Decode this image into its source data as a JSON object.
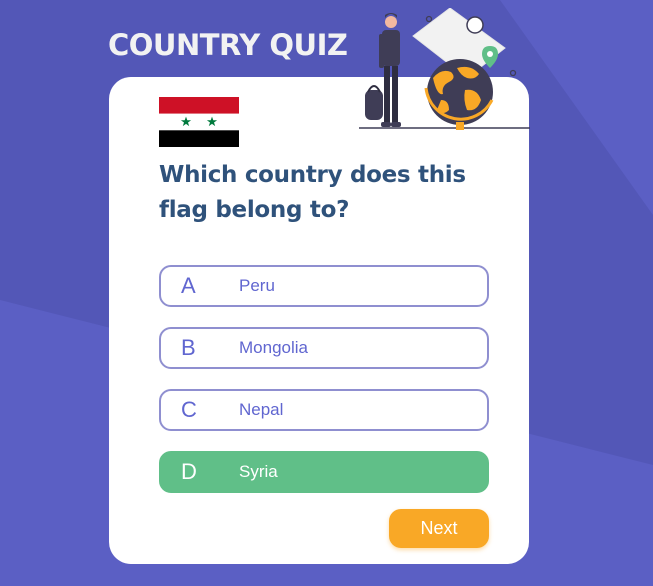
{
  "app": {
    "title": "COUNTRY QUIZ"
  },
  "quiz": {
    "question": "Which country does this flag belong to?",
    "flag": {
      "country_stripes": [
        "#ce1126",
        "#ffffff",
        "#000000"
      ],
      "star_color": "#007a3d"
    },
    "options": [
      {
        "letter": "A",
        "text": "Peru",
        "state": "default"
      },
      {
        "letter": "B",
        "text": "Mongolia",
        "state": "default"
      },
      {
        "letter": "C",
        "text": "Nepal",
        "state": "default"
      },
      {
        "letter": "D",
        "text": "Syria",
        "state": "correct"
      }
    ],
    "next_label": "Next"
  },
  "colors": {
    "background": "#5b5fc4",
    "accent": "#6066d0",
    "correct": "#60bf88",
    "next": "#f9a826",
    "question_text": "#2f527b"
  },
  "icons": {
    "illustration": "traveler-with-globe-illustration"
  }
}
